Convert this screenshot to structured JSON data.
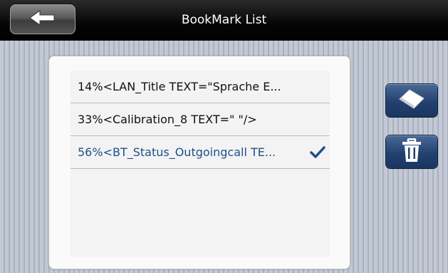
{
  "header": {
    "title": "BookMark List",
    "back_icon": "arrow-left-icon"
  },
  "bookmarks": [
    {
      "label": "14%<LAN_Title TEXT=\"Sprache E...",
      "selected": false
    },
    {
      "label": "33%<Calibration_8 TEXT=\" \"/>",
      "selected": false
    },
    {
      "label": "56%<BT_Status_Outgoingcall TE...",
      "selected": true
    }
  ],
  "side_actions": [
    {
      "icon": "eraser-icon"
    },
    {
      "icon": "trash-icon"
    }
  ],
  "colors": {
    "header_bg": "#000000",
    "selected_text": "#1e4f8a",
    "action_button": "#23416f"
  }
}
